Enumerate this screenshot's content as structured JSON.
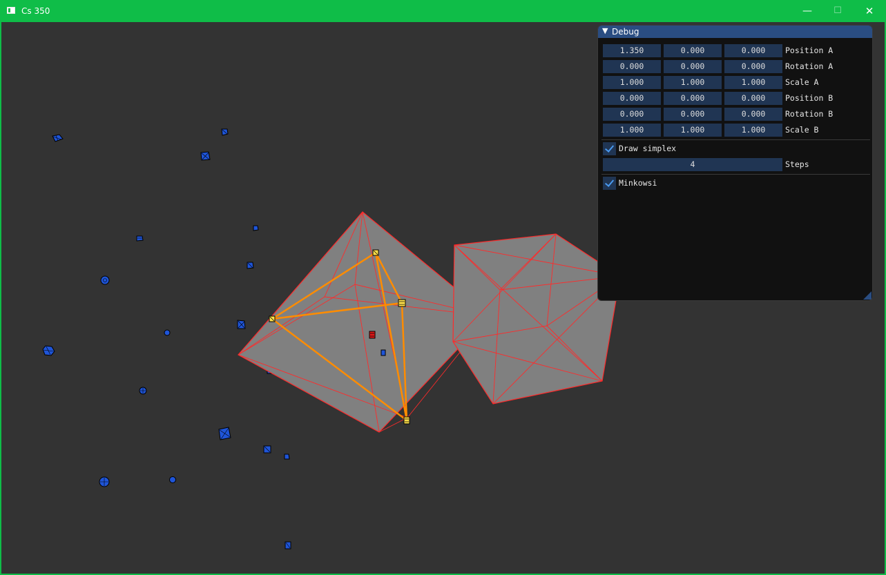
{
  "window": {
    "title": "Cs 350",
    "minimize_glyph": "—",
    "maximize_glyph": "☐",
    "close_glyph": "✕"
  },
  "debug_panel": {
    "title": "Debug",
    "collapse_glyph": "▼",
    "transforms": [
      {
        "label": "Position A",
        "values": [
          "1.350",
          "0.000",
          "0.000"
        ]
      },
      {
        "label": "Rotation A",
        "values": [
          "0.000",
          "0.000",
          "0.000"
        ]
      },
      {
        "label": "Scale A",
        "values": [
          "1.000",
          "1.000",
          "1.000"
        ]
      },
      {
        "label": "Position B",
        "values": [
          "0.000",
          "0.000",
          "0.000"
        ]
      },
      {
        "label": "Rotation B",
        "values": [
          "0.000",
          "0.000",
          "0.000"
        ]
      },
      {
        "label": "Scale B",
        "values": [
          "1.000",
          "1.000",
          "1.000"
        ]
      }
    ],
    "draw_simplex": {
      "label": "Draw simplex",
      "checked": true
    },
    "steps": {
      "label": "Steps",
      "value": "4"
    },
    "minkowski": {
      "label": "Minkowsi",
      "checked": true
    }
  },
  "colors": {
    "titlebar": "#0fbd48",
    "background": "#333333",
    "panel_header": "#2a4d82",
    "wireframe": "#ff2a2a",
    "simplex": "#ff8c00",
    "points": "#1f55d8"
  }
}
